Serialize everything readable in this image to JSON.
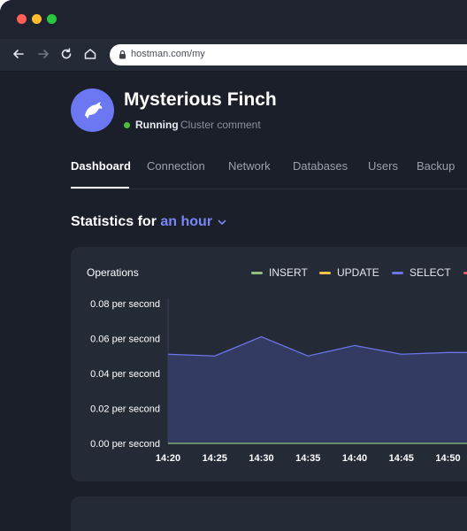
{
  "window_controls": {
    "close_color": "#ff5f57",
    "minimize_color": "#febc2e",
    "maximize_color": "#28c840"
  },
  "browser": {
    "url": "hostman.com/my",
    "icons": [
      "back-arrow-icon",
      "forward-arrow-icon",
      "reload-icon",
      "home-icon",
      "lock-icon"
    ]
  },
  "cluster": {
    "name": "Mysterious Finch",
    "status": "Running",
    "status_color": "#4fbd3e",
    "comment": "Cluster comment",
    "avatar_icon": "dolphin-icon",
    "avatar_color": "#6b78f2"
  },
  "tabs": [
    {
      "label": "Dashboard",
      "active": true
    },
    {
      "label": "Connection",
      "active": false
    },
    {
      "label": "Network",
      "active": false
    },
    {
      "label": "Databases",
      "active": false
    },
    {
      "label": "Users",
      "active": false
    },
    {
      "label": "Backup",
      "active": false
    }
  ],
  "statistics": {
    "prefix": "Statistics for",
    "range": "an hour"
  },
  "chart_card": {
    "title": "Operations"
  },
  "chart_data": {
    "type": "area",
    "title": "Operations",
    "legend_position": "top-right",
    "series": [
      {
        "name": "INSERT",
        "color": "#8fbf7f",
        "values": [
          0,
          0,
          0,
          0,
          0,
          0,
          0,
          0
        ]
      },
      {
        "name": "UPDATE",
        "color": "#f0c24b",
        "values": [
          0,
          0,
          0,
          0,
          0,
          0,
          0,
          0
        ]
      },
      {
        "name": "SELECT",
        "color": "#6b74e8",
        "values": [
          0.051,
          0.05,
          0.061,
          0.05,
          0.056,
          0.051,
          0.052,
          0.052
        ]
      },
      {
        "name": "",
        "color": "#e8566a",
        "values": []
      }
    ],
    "x_points": [
      0,
      5,
      10,
      15,
      20,
      25,
      30,
      35
    ],
    "x_ticks": [
      "14:20",
      "14:25",
      "14:30",
      "14:35",
      "14:40",
      "14:45",
      "14:50"
    ],
    "y_ticks": [
      "0.00 per second",
      "0.02 per second",
      "0.04 per second",
      "0.06 per second",
      "0.08 per second"
    ],
    "ylim": [
      0,
      0.08
    ],
    "grid": true
  }
}
